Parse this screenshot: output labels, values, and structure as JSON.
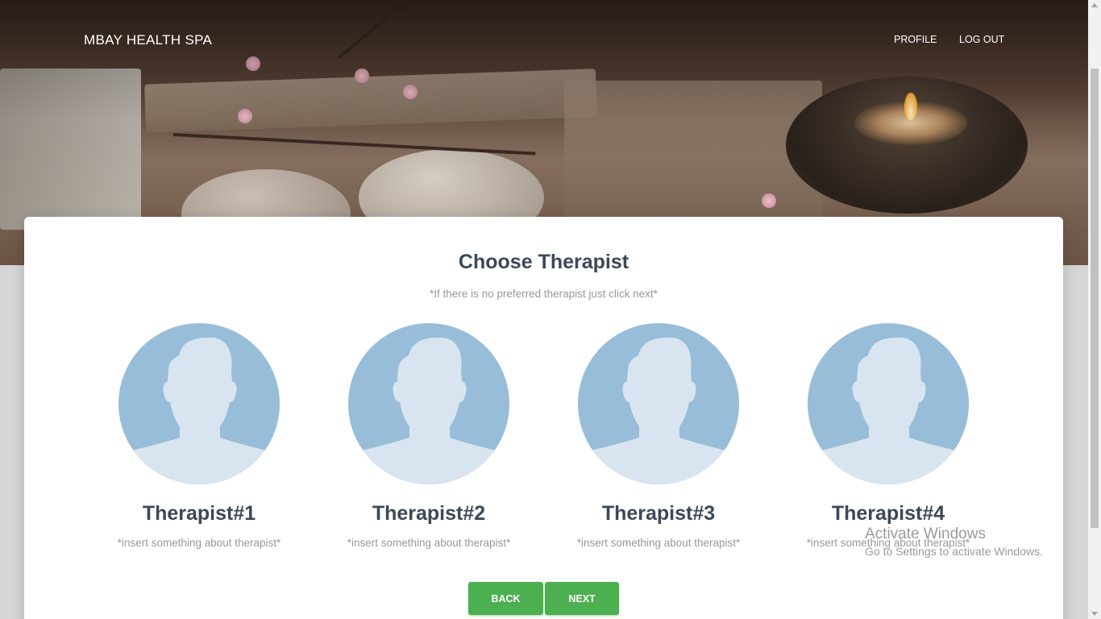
{
  "navbar": {
    "brand": "MBAY HEALTH SPA",
    "links": [
      {
        "label": "PROFILE"
      },
      {
        "label": "LOG OUT"
      }
    ]
  },
  "main": {
    "title": "Choose Therapist",
    "subtitle": "*If there is no preferred therapist just click next*",
    "therapists": [
      {
        "name": "Therapist#1",
        "description": "*insert something about therapist*",
        "avatar_icon": "person-silhouette-icon"
      },
      {
        "name": "Therapist#2",
        "description": "*insert something about therapist*",
        "avatar_icon": "person-silhouette-icon"
      },
      {
        "name": "Therapist#3",
        "description": "*insert something about therapist*",
        "avatar_icon": "person-silhouette-icon"
      },
      {
        "name": "Therapist#4",
        "description": "*insert something about therapist*",
        "avatar_icon": "person-silhouette-icon"
      }
    ],
    "buttons": {
      "back": "BACK",
      "next": "NEXT"
    }
  },
  "watermark": {
    "title": "Activate Windows",
    "subtitle": "Go to Settings to activate Windows."
  },
  "colors": {
    "accent_green": "#4caf50",
    "heading": "#3c4858",
    "muted_text": "#999999",
    "avatar_bg": "#98bdd8",
    "avatar_fg": "#d8e5f0"
  }
}
